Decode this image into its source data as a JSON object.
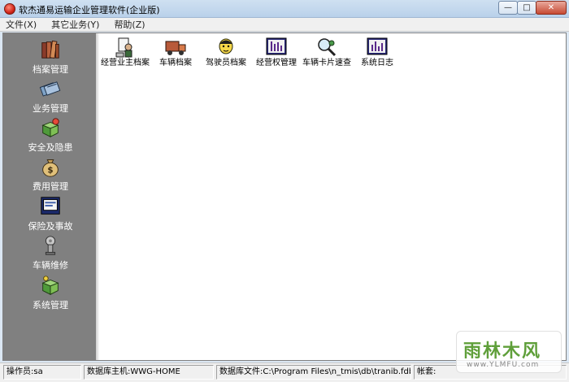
{
  "window": {
    "title": "软杰通易运输企业管理软件(企业版)",
    "minimize_glyph": "—",
    "maximize_glyph": "□",
    "close_glyph": "✕"
  },
  "menu": {
    "items": [
      {
        "label": "文件(X)"
      },
      {
        "label": "其它业务(Y)"
      },
      {
        "label": "帮助(Z)"
      }
    ]
  },
  "sidebar": {
    "items": [
      {
        "label": "档案管理",
        "icon": "books-icon"
      },
      {
        "label": "业务管理",
        "icon": "tickets-icon"
      },
      {
        "label": "安全及隐患",
        "icon": "safety-box-icon"
      },
      {
        "label": "费用管理",
        "icon": "money-bag-icon"
      },
      {
        "label": "保险及事故",
        "icon": "monitor-icon"
      },
      {
        "label": "车辆维修",
        "icon": "wrench-icon"
      },
      {
        "label": "系统管理",
        "icon": "system-box-icon"
      }
    ]
  },
  "content": {
    "items": [
      {
        "label": "经营业主档案",
        "icon": "owner-file-icon"
      },
      {
        "label": "车辆档案",
        "icon": "truck-icon"
      },
      {
        "label": "驾驶员档案",
        "icon": "driver-icon"
      },
      {
        "label": "经营权管理",
        "icon": "chart-board-icon"
      },
      {
        "label": "车辆卡片速查",
        "icon": "magnifier-card-icon"
      },
      {
        "label": "系统日志",
        "icon": "log-board-icon"
      }
    ]
  },
  "status": {
    "operator": "操作员:sa",
    "db_host": "数据库主机:WWG-HOME",
    "db_file": "数据库文件:C:\\Program Files\\n_tmis\\db\\tranib.fdb",
    "account": "帐套:"
  },
  "watermark": {
    "main": "雨林木风",
    "sub": "www.YLMFU.com"
  }
}
